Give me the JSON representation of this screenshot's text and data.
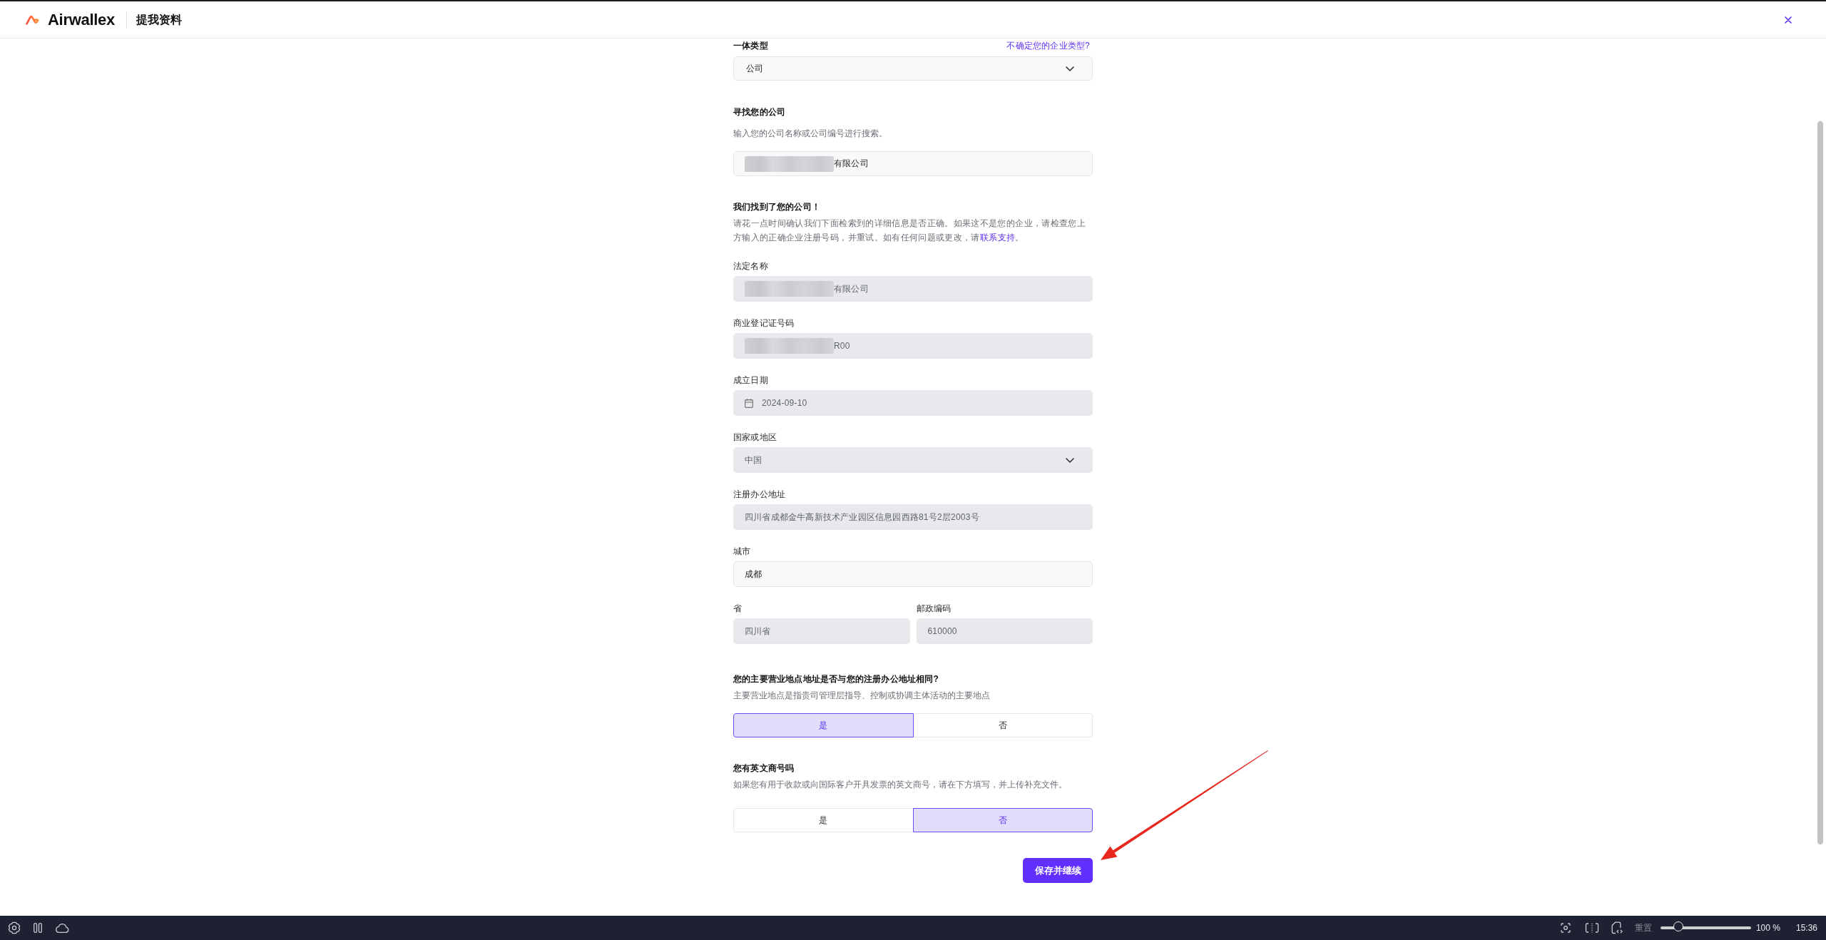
{
  "header": {
    "brand": "Airwallex",
    "title": "提我资料"
  },
  "entity_type": {
    "label": "一体类型",
    "help_link": "不确定您的企业类型?",
    "kind": "select",
    "value": "公司",
    "disabled": false
  },
  "company_search": {
    "title": "寻找您的公司",
    "hint": "输入您的公司名称或公司编号进行搜索。",
    "kind": "text",
    "value": "有限公司",
    "redacted": true,
    "disabled": false
  },
  "match_notice": {
    "title": "我们找到了您的公司！",
    "text": "请花一点时间确认我们下面检索到的详细信息是否正确。如果这不是您的企业，请检查您上方输入的正确企业注册号码，并重试。如有任何问题或更改，请",
    "link": "联系支持",
    "text_after": "。"
  },
  "details": [
    {
      "kind": "text",
      "label": "法定名称",
      "value": "有限公司",
      "redacted": true,
      "disabled": true
    },
    {
      "kind": "text",
      "label": "商业登记证号码",
      "value": "R00",
      "redacted": true,
      "disabled": true
    },
    {
      "kind": "date",
      "label": "成立日期",
      "value": "2024-09-10",
      "redacted": false,
      "disabled": true
    },
    {
      "kind": "select",
      "label": "国家或地区",
      "value": "中国",
      "redacted": false,
      "disabled": true
    },
    {
      "kind": "text",
      "label": "注册办公地址",
      "value": "四川省成都金牛高新技术产业园区信息园西路81号2层2003号",
      "redacted": false,
      "disabled": true
    },
    {
      "kind": "text",
      "label": "城市",
      "value": "成都",
      "redacted": false,
      "disabled": false
    }
  ],
  "details_pair": [
    {
      "kind": "text",
      "label": "省",
      "value": "四川省",
      "redacted": false,
      "disabled": true
    },
    {
      "kind": "text",
      "label": "邮政编码",
      "value": "610000",
      "redacted": false,
      "disabled": true
    }
  ],
  "questions": [
    {
      "title": "您的主要营业地点地址是否与您的注册办公地址相同?",
      "hint": "主要营业地点是指贵司管理层指导、控制或协调主体活动的主要地点",
      "options": [
        {
          "label": "是",
          "selected": true
        },
        {
          "label": "否",
          "selected": false
        }
      ]
    },
    {
      "title": "您有英文商号吗",
      "hint": "如果您有用于收款或向国际客户开具发票的英文商号，请在下方填写，并上传补充文件。",
      "options": [
        {
          "label": "是",
          "selected": false
        },
        {
          "label": "否",
          "selected": true
        }
      ]
    }
  ],
  "save_button": "保存并继续",
  "taskbar": {
    "reset": "重置",
    "zoom": {
      "level": 0.2,
      "reading": "100 %"
    },
    "clock": "15:36"
  }
}
